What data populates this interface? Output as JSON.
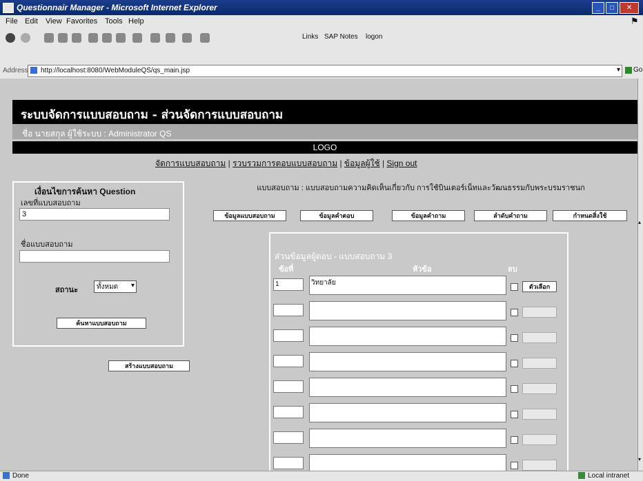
{
  "window": {
    "title": "Questionnair Manager - Microsoft Internet Explorer"
  },
  "menu": [
    "File",
    "Edit",
    "View",
    "Favorites",
    "Tools",
    "Help"
  ],
  "toolbar": {
    "links_label": "Links",
    "link1": "SAP Notes",
    "link2": "logon"
  },
  "address": {
    "label": "Address",
    "url": "http://localhost:8080/WebModuleQS/qs_main.jsp",
    "go": "Go"
  },
  "page": {
    "header_title": "ระบบจัดการแบบสอบถาม - ส่วนจัดการแบบสอบถาม",
    "user_line": "ชื่อ นายสกุล ผู้ใช้ระบบ : Administrator QS",
    "logo": "LOGO",
    "nav": [
      "จัดการแบบสอบถาม",
      "รวบรวมการตอบแบบสอบถาม",
      "ข้อมูลผู้ใช้",
      "Sign out"
    ]
  },
  "search": {
    "title": "เงื่อนไขการค้นหา Question",
    "id_label": "เลขที่แบบสอบถาม",
    "id_value": "3",
    "name_label": "ชื่อแบบสอบถาม",
    "name_value": "",
    "status_label": "สถานะ",
    "status_value": "ทั้งหมด",
    "search_button": "ค้นหาแบบสอบถาม",
    "create_button": "สร้างแบบสอบถาม"
  },
  "questionnaire": {
    "heading": "แบบสอบถาม : แบบสอบถามความคิดเห็นเกี่ยวกับ การใช้บินเตอร์เน็ทและวัฒนธรรมกับพระบรมราชนก",
    "tabs": [
      "ข้อมูลแบบสอบถาม",
      "ข้อมูลคำตอบ",
      "ข้อมูลคำถาม",
      "ลำดับคำถาม",
      "กำหนดสิ่งใช้"
    ],
    "panel_title": "ส่วนข้อมูลผู้ตอบ - แบบสอบถาม 3",
    "col_no": "ข้อที่",
    "col_topic": "หัวข้อ",
    "col_delete": "ลบ",
    "rows": [
      {
        "no": "1",
        "topic": "วิทยาลัย",
        "action": "ตัวเลือก"
      },
      {
        "no": "",
        "topic": "",
        "action": ""
      },
      {
        "no": "",
        "topic": "",
        "action": ""
      },
      {
        "no": "",
        "topic": "",
        "action": ""
      },
      {
        "no": "",
        "topic": "",
        "action": ""
      },
      {
        "no": "",
        "topic": "",
        "action": ""
      },
      {
        "no": "",
        "topic": "",
        "action": ""
      },
      {
        "no": "",
        "topic": "",
        "action": ""
      }
    ]
  },
  "status": {
    "left": "Done",
    "right": "Local intranet"
  }
}
